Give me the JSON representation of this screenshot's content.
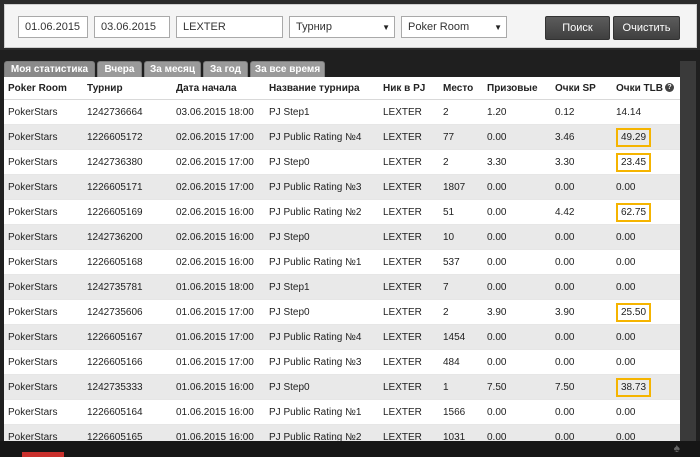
{
  "filters": {
    "date_from": "01.06.2015",
    "date_to": "03.06.2015",
    "nick": "LEXTER",
    "tournament_select": "Турнир",
    "room_select": "Poker Room",
    "search_label": "Поиск",
    "clear_label": "Очистить"
  },
  "tabs": [
    {
      "label": "Моя статистика"
    },
    {
      "label": "Вчера"
    },
    {
      "label": "За месяц"
    },
    {
      "label": "За год"
    },
    {
      "label": "За все время"
    }
  ],
  "table": {
    "headers": {
      "room": "Poker Room",
      "tournament": "Турнир",
      "start": "Дата начала",
      "name": "Название турнира",
      "nick": "Ник в PJ",
      "place": "Место",
      "prize": "Призовые",
      "sp": "Очки SP",
      "tlb": "Очки TLB"
    },
    "rows": [
      {
        "room": "PokerStars",
        "tournament": "1242736664",
        "start": "03.06.2015 18:00",
        "name": "PJ Step1",
        "nick": "LEXTER",
        "place": "2",
        "prize": "1.20",
        "sp": "0.12",
        "tlb": "14.14",
        "highlight": false
      },
      {
        "room": "PokerStars",
        "tournament": "1226605172",
        "start": "02.06.2015 17:00",
        "name": "PJ Public Rating №4",
        "nick": "LEXTER",
        "place": "77",
        "prize": "0.00",
        "sp": "3.46",
        "tlb": "49.29",
        "highlight": true
      },
      {
        "room": "PokerStars",
        "tournament": "1242736380",
        "start": "02.06.2015 17:00",
        "name": "PJ Step0",
        "nick": "LEXTER",
        "place": "2",
        "prize": "3.30",
        "sp": "3.30",
        "tlb": "23.45",
        "highlight": true
      },
      {
        "room": "PokerStars",
        "tournament": "1226605171",
        "start": "02.06.2015 17:00",
        "name": "PJ Public Rating №3",
        "nick": "LEXTER",
        "place": "1807",
        "prize": "0.00",
        "sp": "0.00",
        "tlb": "0.00",
        "highlight": false
      },
      {
        "room": "PokerStars",
        "tournament": "1226605169",
        "start": "02.06.2015 16:00",
        "name": "PJ Public Rating №2",
        "nick": "LEXTER",
        "place": "51",
        "prize": "0.00",
        "sp": "4.42",
        "tlb": "62.75",
        "highlight": true
      },
      {
        "room": "PokerStars",
        "tournament": "1242736200",
        "start": "02.06.2015 16:00",
        "name": "PJ Step0",
        "nick": "LEXTER",
        "place": "10",
        "prize": "0.00",
        "sp": "0.00",
        "tlb": "0.00",
        "highlight": false
      },
      {
        "room": "PokerStars",
        "tournament": "1226605168",
        "start": "02.06.2015 16:00",
        "name": "PJ Public Rating №1",
        "nick": "LEXTER",
        "place": "537",
        "prize": "0.00",
        "sp": "0.00",
        "tlb": "0.00",
        "highlight": false
      },
      {
        "room": "PokerStars",
        "tournament": "1242735781",
        "start": "01.06.2015 18:00",
        "name": "PJ Step1",
        "nick": "LEXTER",
        "place": "7",
        "prize": "0.00",
        "sp": "0.00",
        "tlb": "0.00",
        "highlight": false
      },
      {
        "room": "PokerStars",
        "tournament": "1242735606",
        "start": "01.06.2015 17:00",
        "name": "PJ Step0",
        "nick": "LEXTER",
        "place": "2",
        "prize": "3.90",
        "sp": "3.90",
        "tlb": "25.50",
        "highlight": true
      },
      {
        "room": "PokerStars",
        "tournament": "1226605167",
        "start": "01.06.2015 17:00",
        "name": "PJ Public Rating №4",
        "nick": "LEXTER",
        "place": "1454",
        "prize": "0.00",
        "sp": "0.00",
        "tlb": "0.00",
        "highlight": false
      },
      {
        "room": "PokerStars",
        "tournament": "1226605166",
        "start": "01.06.2015 17:00",
        "name": "PJ Public Rating №3",
        "nick": "LEXTER",
        "place": "484",
        "prize": "0.00",
        "sp": "0.00",
        "tlb": "0.00",
        "highlight": false
      },
      {
        "room": "PokerStars",
        "tournament": "1242735333",
        "start": "01.06.2015 16:00",
        "name": "PJ Step0",
        "nick": "LEXTER",
        "place": "1",
        "prize": "7.50",
        "sp": "7.50",
        "tlb": "38.73",
        "highlight": true
      },
      {
        "room": "PokerStars",
        "tournament": "1226605164",
        "start": "01.06.2015 16:00",
        "name": "PJ Public Rating №1",
        "nick": "LEXTER",
        "place": "1566",
        "prize": "0.00",
        "sp": "0.00",
        "tlb": "0.00",
        "highlight": false
      },
      {
        "room": "PokerStars",
        "tournament": "1226605165",
        "start": "01.06.2015 16:00",
        "name": "PJ Public Rating №2",
        "nick": "LEXTER",
        "place": "1031",
        "prize": "0.00",
        "sp": "0.00",
        "tlb": "0.00",
        "highlight": false
      }
    ]
  },
  "colors": {
    "highlight_border": "#f5b400",
    "page_background": "#1f1f1f"
  },
  "icons": {
    "help": "question-circle-icon",
    "select_caret": "chevron-down-icon"
  }
}
